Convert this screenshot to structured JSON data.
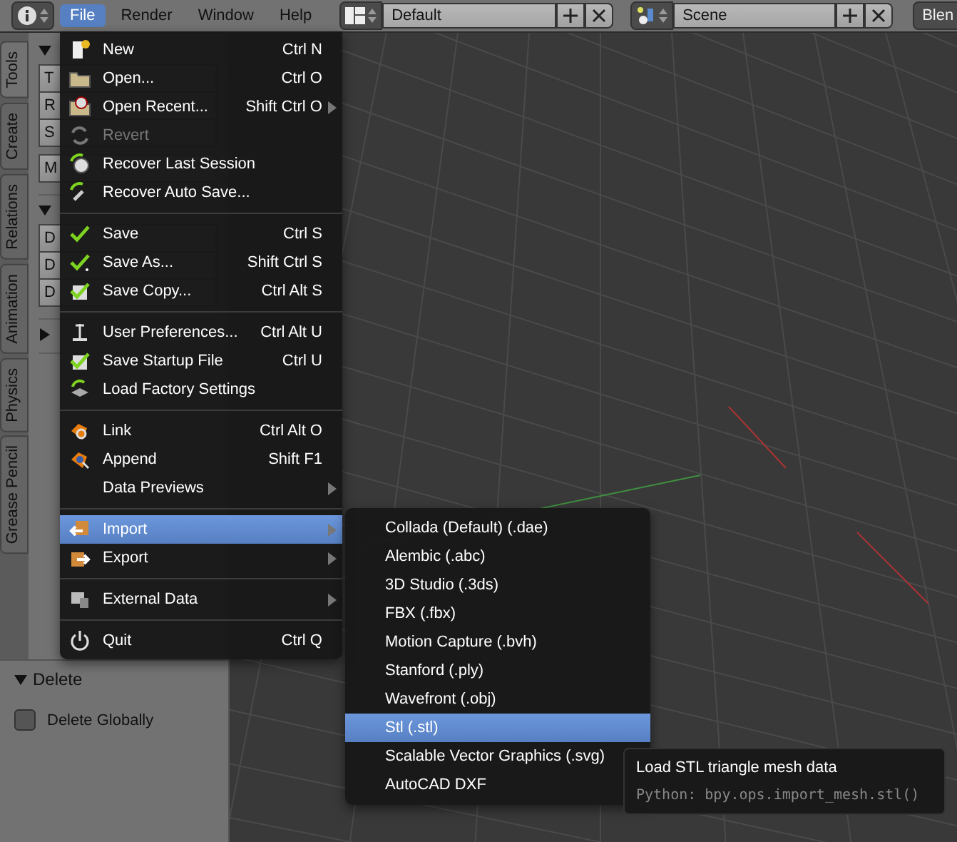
{
  "topbar": {
    "menus": [
      {
        "label": "File",
        "selected": true
      },
      {
        "label": "Render",
        "selected": false
      },
      {
        "label": "Window",
        "selected": false
      },
      {
        "label": "Help",
        "selected": false
      }
    ],
    "layout": {
      "value": "Default"
    },
    "scene": {
      "value": "Scene"
    },
    "engine": {
      "label": "Blen"
    }
  },
  "sidebar": {
    "tabs": [
      {
        "label": "Tools",
        "selected": true
      },
      {
        "label": "Create",
        "selected": false
      },
      {
        "label": "Relations",
        "selected": false
      },
      {
        "label": "Animation",
        "selected": false
      },
      {
        "label": "Physics",
        "selected": false
      },
      {
        "label": "Grease Pencil",
        "selected": false
      }
    ],
    "sections": [
      {
        "expanded": true,
        "groups": [
          [
            "T",
            "R",
            "S"
          ],
          [
            "M"
          ]
        ]
      },
      {
        "expanded": true,
        "groups": [
          [
            "D",
            "D",
            "D"
          ]
        ]
      },
      {
        "expanded": false
      }
    ]
  },
  "operator_panel": {
    "title": "Delete",
    "expanded": true,
    "options": [
      {
        "label": "Delete Globally",
        "checked": false
      }
    ]
  },
  "file_menu": {
    "items": [
      {
        "kind": "item",
        "label": "New",
        "shortcut": "Ctrl N",
        "submenu": false,
        "disabled": false,
        "selected": false
      },
      {
        "kind": "item",
        "label": "Open...",
        "shortcut": "Ctrl O",
        "submenu": false,
        "disabled": false,
        "selected": false
      },
      {
        "kind": "item",
        "label": "Open Recent...",
        "shortcut": "Shift Ctrl O",
        "submenu": true,
        "disabled": false,
        "selected": false
      },
      {
        "kind": "item",
        "label": "Revert",
        "submenu": false,
        "disabled": true,
        "selected": false
      },
      {
        "kind": "item",
        "label": "Recover Last Session",
        "submenu": false,
        "disabled": false,
        "selected": false
      },
      {
        "kind": "item",
        "label": "Recover Auto Save...",
        "submenu": false,
        "disabled": false,
        "selected": false
      },
      {
        "kind": "separator"
      },
      {
        "kind": "item",
        "label": "Save",
        "shortcut": "Ctrl S",
        "submenu": false,
        "disabled": false,
        "selected": false
      },
      {
        "kind": "item",
        "label": "Save As...",
        "shortcut": "Shift Ctrl S",
        "submenu": false,
        "disabled": false,
        "selected": false
      },
      {
        "kind": "item",
        "label": "Save Copy...",
        "shortcut": "Ctrl Alt S",
        "submenu": false,
        "disabled": false,
        "selected": false
      },
      {
        "kind": "separator"
      },
      {
        "kind": "item",
        "label": "User Preferences...",
        "shortcut": "Ctrl Alt U",
        "submenu": false,
        "disabled": false,
        "selected": false
      },
      {
        "kind": "item",
        "label": "Save Startup File",
        "shortcut": "Ctrl U",
        "submenu": false,
        "disabled": false,
        "selected": false
      },
      {
        "kind": "item",
        "label": "Load Factory Settings",
        "submenu": false,
        "disabled": false,
        "selected": false
      },
      {
        "kind": "separator"
      },
      {
        "kind": "item",
        "label": "Link",
        "shortcut": "Ctrl Alt O",
        "submenu": false,
        "disabled": false,
        "selected": false
      },
      {
        "kind": "item",
        "label": "Append",
        "shortcut": "Shift F1",
        "submenu": false,
        "disabled": false,
        "selected": false
      },
      {
        "kind": "item",
        "label": "Data Previews",
        "submenu": true,
        "disabled": false,
        "selected": false
      },
      {
        "kind": "separator"
      },
      {
        "kind": "item",
        "label": "Import",
        "submenu": true,
        "disabled": false,
        "selected": true
      },
      {
        "kind": "item",
        "label": "Export",
        "submenu": true,
        "disabled": false,
        "selected": false
      },
      {
        "kind": "separator"
      },
      {
        "kind": "item",
        "label": "External Data",
        "submenu": true,
        "disabled": false,
        "selected": false
      },
      {
        "kind": "separator"
      },
      {
        "kind": "item",
        "label": "Quit",
        "shortcut": "Ctrl Q",
        "submenu": false,
        "disabled": false,
        "selected": false
      }
    ]
  },
  "import_menu": {
    "items": [
      {
        "label": "Collada (Default) (.dae)",
        "selected": false
      },
      {
        "label": "Alembic (.abc)",
        "selected": false
      },
      {
        "label": "3D Studio (.3ds)",
        "selected": false
      },
      {
        "label": "FBX (.fbx)",
        "selected": false
      },
      {
        "label": "Motion Capture (.bvh)",
        "selected": false
      },
      {
        "label": "Stanford (.ply)",
        "selected": false
      },
      {
        "label": "Wavefront (.obj)",
        "selected": false
      },
      {
        "label": "Stl (.stl)",
        "selected": true
      },
      {
        "label": "Scalable Vector Graphics (.svg)",
        "selected": false
      },
      {
        "label": "AutoCAD DXF",
        "selected": false
      }
    ]
  },
  "tooltip": {
    "title": "Load STL triangle mesh data",
    "python": "Python: bpy.ops.import_mesh.stl()"
  }
}
